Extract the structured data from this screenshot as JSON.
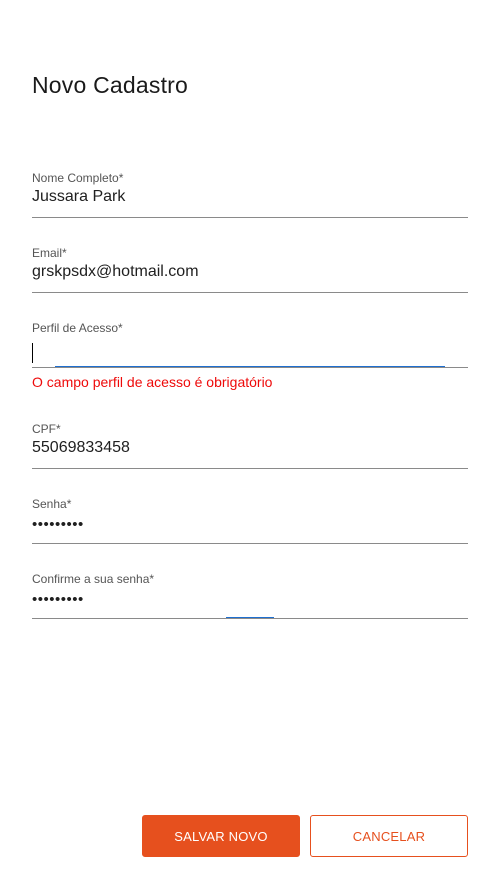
{
  "header": {
    "title": "Novo Cadastro"
  },
  "form": {
    "nome": {
      "label": "Nome Completo*",
      "value": "Jussara Park"
    },
    "email": {
      "label": "Email*",
      "value": "grskpsdx@hotmail.com"
    },
    "perfil": {
      "label": "Perfil de Acesso*",
      "value": "",
      "error": "O campo perfil de acesso é obrigatório"
    },
    "cpf": {
      "label": "CPF*",
      "value": "55069833458"
    },
    "senha": {
      "label": "Senha*",
      "value": "•••••••••"
    },
    "confirma": {
      "label": "Confirme a sua senha*",
      "value": "•••••••••"
    }
  },
  "actions": {
    "save_label": "SALVAR NOVO",
    "cancel_label": "CANCELAR"
  },
  "colors": {
    "accent": "#e6501e",
    "error": "#ee0a0a",
    "focus": "#1e6fd0"
  }
}
